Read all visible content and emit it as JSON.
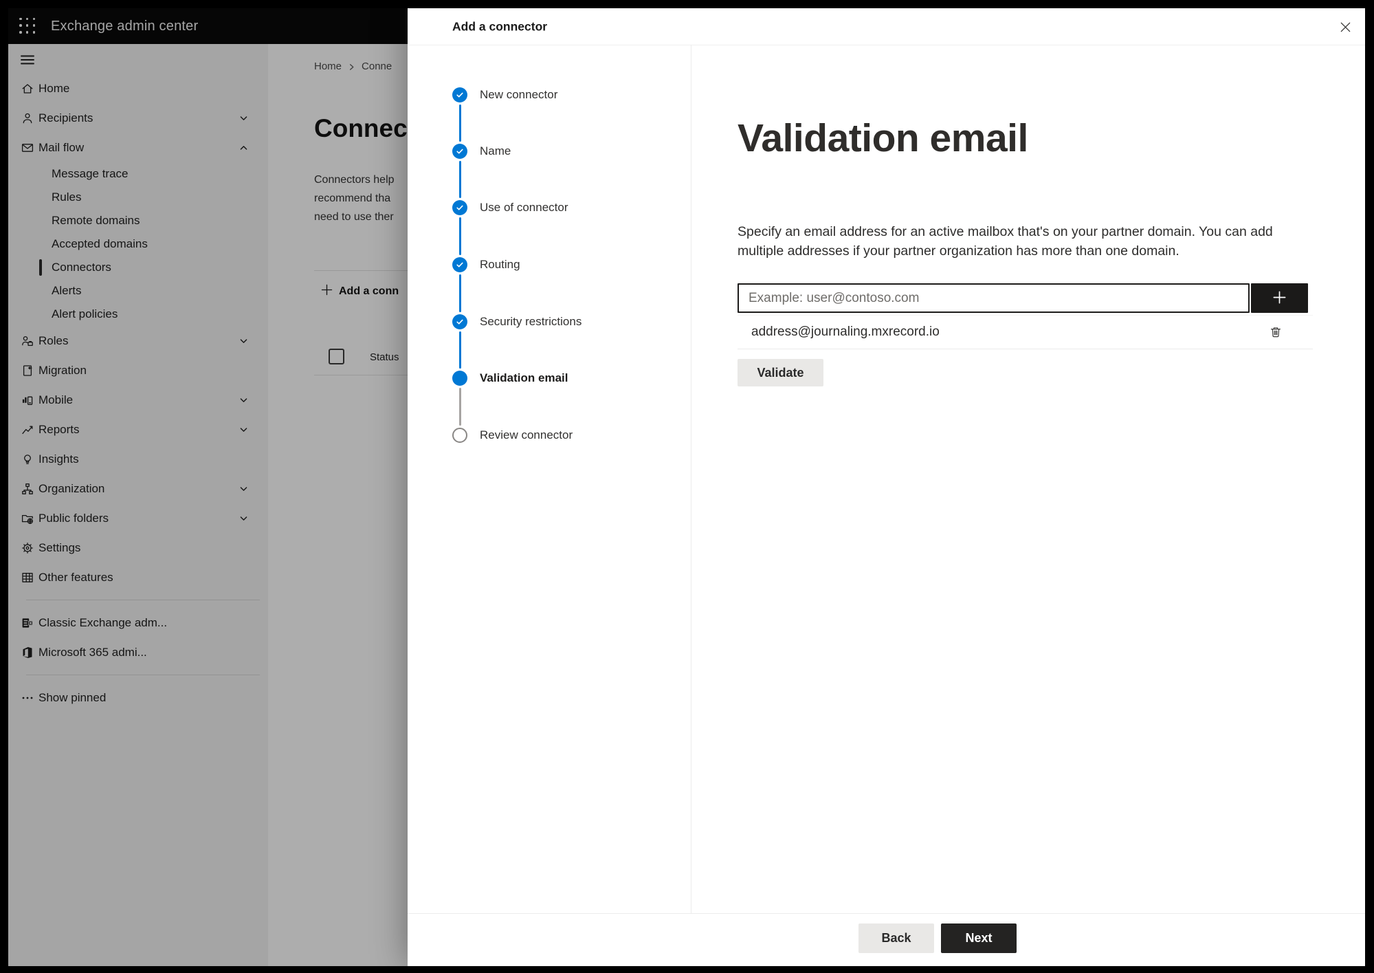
{
  "topbar": {
    "title": "Exchange admin center",
    "app_launcher_icon": "waffle-icon"
  },
  "sidebar": {
    "menu_icon": "hamburger-icon",
    "items": [
      {
        "label": "Home",
        "icon": "home-icon"
      },
      {
        "label": "Recipients",
        "icon": "person-icon",
        "chevron": "down"
      },
      {
        "label": "Mail flow",
        "icon": "mail-icon",
        "chevron": "up"
      },
      {
        "label": "Message trace",
        "sub": true
      },
      {
        "label": "Rules",
        "sub": true
      },
      {
        "label": "Remote domains",
        "sub": true
      },
      {
        "label": "Accepted domains",
        "sub": true
      },
      {
        "label": "Connectors",
        "sub": true,
        "selected": true
      },
      {
        "label": "Alerts",
        "sub": true
      },
      {
        "label": "Alert policies",
        "sub": true
      },
      {
        "label": "Roles",
        "icon": "roles-icon",
        "chevron": "down"
      },
      {
        "label": "Migration",
        "icon": "migration-icon"
      },
      {
        "label": "Mobile",
        "icon": "mobile-icon",
        "chevron": "down"
      },
      {
        "label": "Reports",
        "icon": "reports-icon",
        "chevron": "down"
      },
      {
        "label": "Insights",
        "icon": "lightbulb-icon"
      },
      {
        "label": "Organization",
        "icon": "org-icon",
        "chevron": "down"
      },
      {
        "label": "Public folders",
        "icon": "public-folder-icon",
        "chevron": "down"
      },
      {
        "label": "Settings",
        "icon": "gear-icon"
      },
      {
        "label": "Other features",
        "icon": "grid-icon"
      },
      {
        "divider": true
      },
      {
        "label": "Classic Exchange adm...",
        "icon": "exchange-icon"
      },
      {
        "label": "Microsoft 365 admi...",
        "icon": "office-icon"
      },
      {
        "divider": true
      },
      {
        "label": "Show pinned",
        "icon": "ellipsis-icon"
      }
    ]
  },
  "page": {
    "breadcrumb": {
      "home": "Home",
      "current": "Conne"
    },
    "heading": "Connecto",
    "description_lines": [
      "Connectors help",
      "recommend tha",
      "need to use ther"
    ],
    "add_button": "Add a conn",
    "status_header": "Status"
  },
  "dialog": {
    "title": "Add a connector",
    "close_icon": "close-icon",
    "steps": [
      {
        "label": "New connector",
        "state": "done"
      },
      {
        "label": "Name",
        "state": "done"
      },
      {
        "label": "Use of connector",
        "state": "done"
      },
      {
        "label": "Routing",
        "state": "done"
      },
      {
        "label": "Security restrictions",
        "state": "done"
      },
      {
        "label": "Validation email",
        "state": "current"
      },
      {
        "label": "Review connector",
        "state": "todo"
      }
    ],
    "content": {
      "heading": "Validation email",
      "description_lines": [
        "Specify an email address for an active mailbox that's on your partner domain. You can add",
        "multiple addresses if your partner organization has more than one domain."
      ],
      "email_placeholder": "Example: user@contoso.com",
      "add_icon": "plus-icon",
      "addresses": [
        {
          "email": "address@journaling.mxrecord.io",
          "delete_icon": "trash-icon"
        }
      ],
      "validate_button": "Validate"
    },
    "footer": {
      "back_button": "Back",
      "next_button": "Next"
    }
  },
  "colors": {
    "accent_blue": "#0078d4",
    "dark_button": "#1b1a19",
    "text_primary": "#323130",
    "step_todo_border": "#8a8886",
    "overlay": "rgba(0,0,0,0.32)"
  }
}
